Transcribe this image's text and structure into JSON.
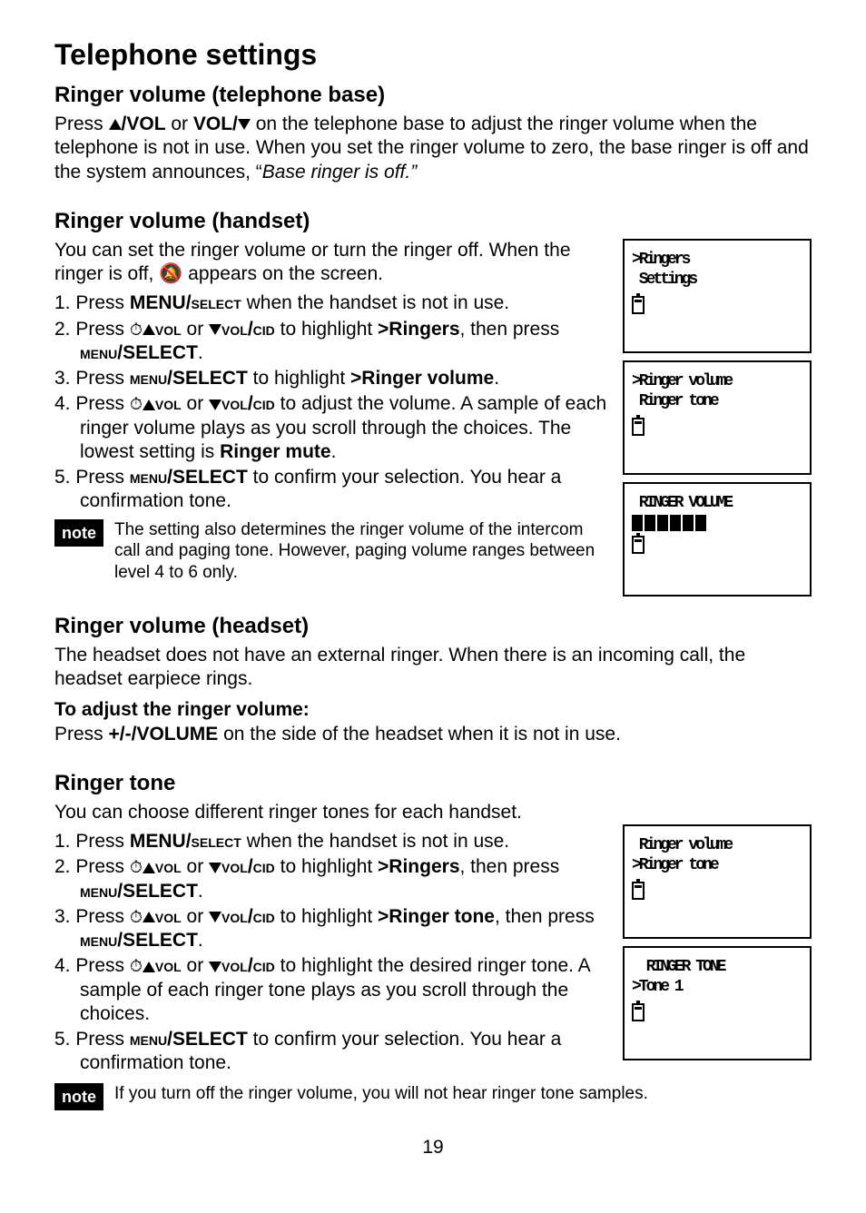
{
  "title": "Telephone settings",
  "sections": {
    "base": {
      "heading": "Ringer volume (telephone base)",
      "para_pre": "Press ",
      "vol_up": "/VOL",
      "or": " or ",
      "vol_down": "VOL/",
      "para_post": " on the telephone base to adjust the ringer volume when the telephone is not in use. When you set the ringer volume to zero, the base ringer is off and the system announces, “",
      "italic": "Base ringer is off.”"
    },
    "handset": {
      "heading": "Ringer volume (handset)",
      "intro_a": "You can set the ringer volume or turn the ringer off. When the ringer is off, ",
      "intro_b": " appears on the screen.",
      "steps": {
        "1_pre": "1.  Press ",
        "1_b": "MENU/",
        "1_sc": "select",
        "1_post": " when the handset is not in use.",
        "2_pre": "2.  Press ",
        "2_sc1": "vol",
        "2_mid1": " or ",
        "2_sc2": "vol",
        "2_mid2": "/",
        "2_sc3": "cid",
        "2_mid3": " to highlight ",
        "2_b": ">Ringers",
        "2_post": ", then press ",
        "2_sc4": "menu",
        "2_b2": "/SELECT",
        "2_end": ".",
        "3_pre": "3.  Press ",
        "3_sc": "menu",
        "3_b": "/SELECT",
        "3_mid": " to highlight ",
        "3_b2": ">Ringer volume",
        "3_end": ".",
        "4_pre": "4.  Press ",
        "4_sc1": "vol",
        "4_mid1": " or ",
        "4_sc2": "vol",
        "4_mid2": "/",
        "4_sc3": "cid",
        "4_post": " to adjust the volume. A sample of each ringer volume plays as you scroll through the choices. The lowest setting is ",
        "4_b": "Ringer mute",
        "4_end": ".",
        "5_pre": "5.  Press ",
        "5_sc": "menu",
        "5_b": "/SELECT",
        "5_post": " to confirm your selection. You hear a confirmation tone."
      },
      "note": "The setting also determines the ringer volume of the intercom call and paging tone. However, paging volume ranges between level 4 to 6 only."
    },
    "headset": {
      "heading": "Ringer volume (headset)",
      "para": "The headset does not have an external ringer. When there is an incoming call, the headset earpiece rings.",
      "sub": "To adjust the ringer volume:",
      "para2_pre": "Press ",
      "para2_b": "+/-/VOLUME",
      "para2_post": " on the side of the headset when it is not in use."
    },
    "tone": {
      "heading": "Ringer tone",
      "intro": "You can choose different ringer tones for each handset.",
      "steps": {
        "1_pre": "1.  Press ",
        "1_b": "MENU/",
        "1_sc": "select",
        "1_post": " when the handset is not in use.",
        "2_pre": "2.  Press ",
        "2_sc1": "vol",
        "2_mid1": " or ",
        "2_sc2": "vol",
        "2_mid2": "/",
        "2_sc3": "cid",
        "2_mid3": " to highlight ",
        "2_b": ">Ringers",
        "2_post": ", then press ",
        "2_sc4": "menu",
        "2_b2": "/SELECT",
        "2_end": ".",
        "3_pre": "3.  Press ",
        "3_sc1": "vol",
        "3_mid1": " or ",
        "3_sc2": "vol",
        "3_mid2": "/",
        "3_sc3": "cid",
        "3_mid3": " to highlight ",
        "3_b": ">Ringer tone",
        "3_post": ", then press ",
        "3_sc4": "menu",
        "3_b2": "/SELECT",
        "3_end": ".",
        "4_pre": "4.  Press ",
        "4_sc1": "vol",
        "4_mid1": " or ",
        "4_sc2": "vol",
        "4_mid2": "/",
        "4_sc3": "cid",
        "4_post": " to highlight the desired ringer tone. A sample of each ringer tone plays as you scroll through the choices.",
        "5_pre": "5.  Press ",
        "5_sc": "menu",
        "5_b": "/SELECT",
        "5_post": " to confirm your selection. You hear a confirmation tone."
      },
      "note": "If you turn off the ringer volume, you will not hear ringer tone samples."
    }
  },
  "lcd": {
    "box1_l1": ">Ringers",
    "box1_l2": " Settings",
    "box2_l1": ">Ringer volume",
    "box2_l2": " Ringer tone",
    "box3_l1": " RINGER VOLUME",
    "box4_l1": " Ringer volume",
    "box4_l2": ">Ringer tone",
    "box5_l1": "  RINGER TONE",
    "box5_l2": ">Tone 1"
  },
  "note_label": "note",
  "clock_symbol": "/",
  "page": "19"
}
